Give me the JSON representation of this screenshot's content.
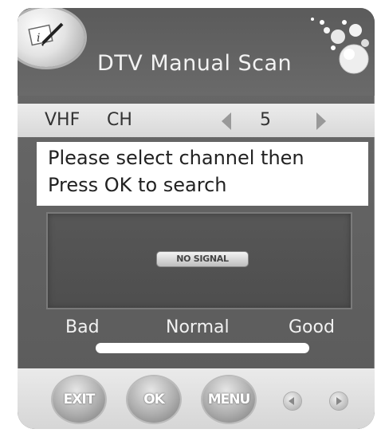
{
  "header": {
    "title": "DTV Manual Scan"
  },
  "channel": {
    "label": "VHF",
    "unit": "CH",
    "value": "5"
  },
  "message": {
    "line1": "Please select channel then",
    "line2": "Press OK to search"
  },
  "signal": {
    "status": "NO SIGNAL",
    "level": 0
  },
  "quality": {
    "bad": "Bad",
    "normal": "Normal",
    "good": "Good"
  },
  "buttons": {
    "exit": "EXIT",
    "ok": "OK",
    "menu": "MENU"
  },
  "icons": {
    "logo": "document-pen-icon",
    "decor": "bubbles-icon",
    "left": "chevron-left-icon",
    "right": "chevron-right-icon"
  }
}
